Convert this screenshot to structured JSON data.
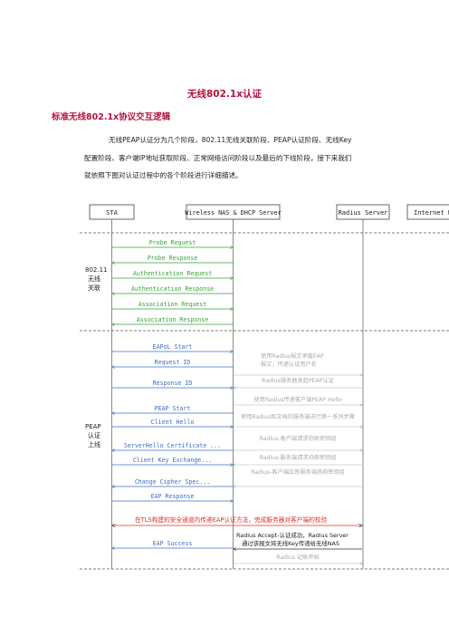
{
  "document": {
    "title": "无线802.1x认证",
    "subtitle": "标准无线802.1x协议交互逻辑",
    "paragraph": [
      "无线PEAP认证分为几个阶段，802.11无线关联阶段、PEAP认证阶段、无线Key",
      "配置阶段、客户端IP地址获取阶段、正常网络访问阶段以及最后的下线阶段，接下来我们",
      "就依照下图对认证过程中的各个阶段进行详细描述。"
    ]
  },
  "diagram": {
    "entities": [
      "STA",
      "Wireless NAS & DHCP Server",
      "Radius Server",
      "Internet W"
    ],
    "phases": [
      {
        "label": [
          "802.11",
          "无线",
          "关联"
        ]
      },
      {
        "label": [
          "PEAP",
          "认证",
          "上线"
        ]
      }
    ],
    "sta_nas_messages": [
      {
        "text": "Probe Request",
        "dir": "right",
        "color": "#3aa33a"
      },
      {
        "text": "Probe Response",
        "dir": "left",
        "color": "#3aa33a"
      },
      {
        "text": "Authentication Request",
        "dir": "right",
        "color": "#3aa33a"
      },
      {
        "text": "Authentication Response",
        "dir": "left",
        "color": "#3aa33a"
      },
      {
        "text": "Association Request",
        "dir": "right",
        "color": "#3aa33a"
      },
      {
        "text": "Association Response",
        "dir": "left",
        "color": "#3aa33a"
      },
      {
        "text": "EAPoL Start",
        "dir": "right",
        "color": "#3d6fc9"
      },
      {
        "text": "Request ID",
        "dir": "left",
        "color": "#3d6fc9"
      },
      {
        "text": "Response ID",
        "dir": "right",
        "color": "#3d6fc9"
      },
      {
        "text": "PEAP Start",
        "dir": "left",
        "color": "#3d6fc9"
      },
      {
        "text": "Client Hello",
        "dir": "right",
        "color": "#3d6fc9"
      },
      {
        "text": "ServerHello Certificate ...",
        "dir": "left",
        "color": "#3d6fc9"
      },
      {
        "text": "Client Key Exchange...",
        "dir": "right",
        "color": "#3d6fc9"
      },
      {
        "text": "Change Cipher Spec...",
        "dir": "left",
        "color": "#3d6fc9"
      },
      {
        "text": "EAP Response",
        "dir": "right",
        "color": "#3d6fc9"
      },
      {
        "text": "EAP Success",
        "dir": "left",
        "color": "#3d6fc9"
      }
    ],
    "nas_radius_messages": [
      "使用Radius报文承载EAP 报文，传递认证用户名",
      "Radius服务器发起PEAP认证",
      "使用Radius传递客户端PEAP Hello",
      "使用Radius和文档的服务端进行第一系列步骤",
      "Radius-客户端请求协商密钥组",
      "Radius-服务端请求协商密钥组",
      "Radius-客户端应答服务端协商密钥组",
      "Radius 记账开始"
    ],
    "tls_note": "在TLS构建的安全通道内传递EAP认证方法，完成服务器对客户端的校验",
    "accept_note": [
      "Radius Accept-认证成功，Radius Server",
      "通过该报文将无线Key传递给无线NAS"
    ]
  }
}
